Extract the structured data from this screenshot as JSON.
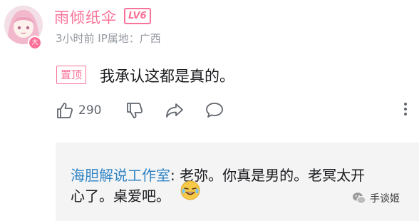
{
  "comment": {
    "username": "雨倾纸伞",
    "level_badge": "LV6",
    "avatar_badge": "大",
    "meta": "3小时前 IP属地：广西",
    "pinned_label": "置顶",
    "content": "我承认这都是真的。",
    "likes": "290"
  },
  "reply": {
    "author": "海胆解说工作室",
    "separator": ": ",
    "text_line1": "老弥。你真是男的。老冥太开",
    "text_line2": "心了。桌爱吧。"
  },
  "watermark": {
    "label": "手谈姬"
  },
  "colors": {
    "accent_pink": "#fb7299",
    "link_blue": "#2f84c5",
    "meta_gray": "#9499a0",
    "icon_gray": "#61666d",
    "reply_bg": "#f4f4f4"
  },
  "icons": [
    "thumb-up-icon",
    "thumb-down-icon",
    "share-icon",
    "comment-icon",
    "more-icon",
    "wechat-icon",
    "laughing-cry-emoji"
  ]
}
